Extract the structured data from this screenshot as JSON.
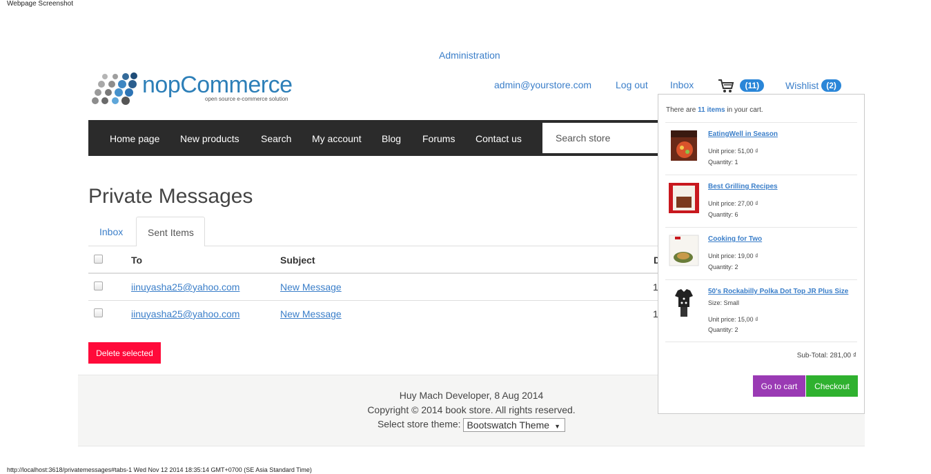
{
  "captions": {
    "top": "Webpage Screenshot",
    "bottom": "http://localhost:3618/privatemessages#tabs-1 Wed Nov 12 2014 18:35:14 GMT+0700 (SE Asia Standard Time)"
  },
  "header": {
    "admin_link": "Administration",
    "logo_text": "nopCommerce",
    "logo_tagline": "open source e-commerce solution",
    "account_email": "admin@yourstore.com",
    "logout": "Log out",
    "inbox": "Inbox",
    "cart_count": "(11)",
    "wishlist": "Wishlist",
    "wishlist_count": "(2)"
  },
  "nav": {
    "items": [
      "Home page",
      "New products",
      "Search",
      "My account",
      "Blog",
      "Forums",
      "Contact us"
    ],
    "search_placeholder": "Search store"
  },
  "main": {
    "title": "Private Messages",
    "tabs": [
      "Inbox",
      "Sent Items"
    ],
    "active_tab": "Sent Items",
    "columns": [
      "To",
      "Subject",
      "D"
    ],
    "rows": [
      {
        "to": "iinuyasha25@yahoo.com",
        "subject": "New Message",
        "date": "1"
      },
      {
        "to": "iinuyasha25@yahoo.com",
        "subject": "New Message",
        "date": "1"
      }
    ],
    "delete_button": "Delete selected"
  },
  "footer": {
    "line1": "Huy Mach Developer, 8 Aug 2014",
    "line2": "Copyright © 2014 book store. All rights reserved.",
    "theme_label": "Select store theme:",
    "theme_value": "Bootswatch Theme"
  },
  "flyout_cart": {
    "count_prefix": "There are",
    "count_items": "11 items",
    "count_suffix": "in your cart.",
    "items": [
      {
        "name": "EatingWell in Season",
        "attr": "",
        "unit_price": "Unit price: 51,00 ₫",
        "quantity": "Quantity: 1"
      },
      {
        "name": "Best Grilling Recipes",
        "attr": "",
        "unit_price": "Unit price: 27,00 ₫",
        "quantity": "Quantity: 6"
      },
      {
        "name": "Cooking for Two",
        "attr": "",
        "unit_price": "Unit price: 19,00 ₫",
        "quantity": "Quantity: 2"
      },
      {
        "name": "50's Rockabilly Polka Dot Top JR Plus Size",
        "attr": "Size: Small",
        "unit_price": "Unit price: 15,00 ₫",
        "quantity": "Quantity: 2"
      }
    ],
    "subtotal": "Sub-Total: 281,00 ₫",
    "go_to_cart": "Go to cart",
    "checkout": "Checkout"
  },
  "colors": {
    "link": "#3a7ec9",
    "nav_bg": "#2b2b2b",
    "delete": "#ff0a3a",
    "go_to_cart": "#9a3ab4",
    "checkout": "#2fb12f",
    "badge": "#2a86d8"
  }
}
